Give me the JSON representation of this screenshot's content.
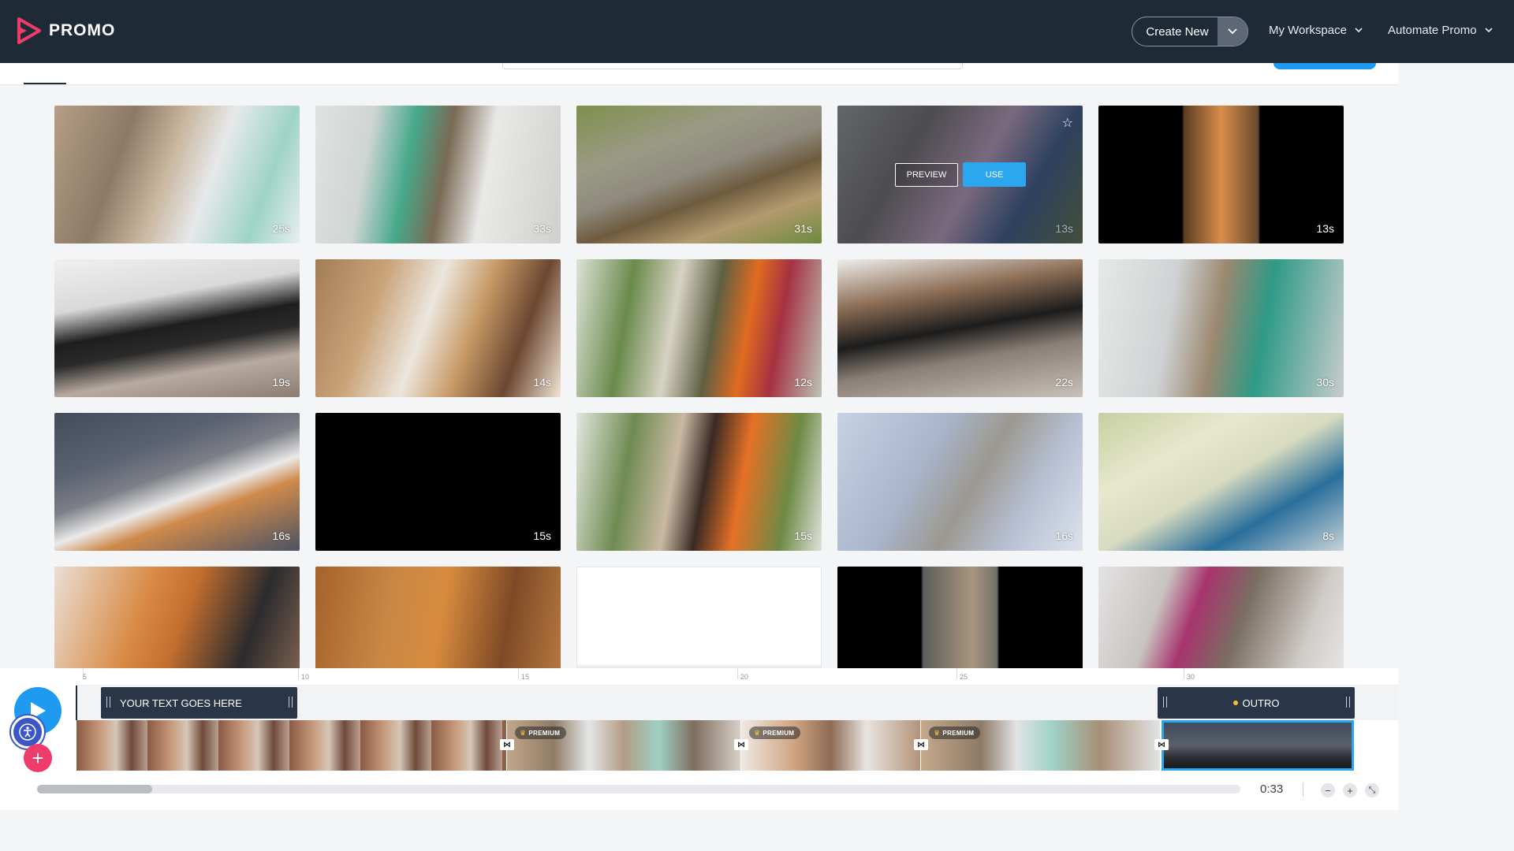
{
  "brand": {
    "name": "PROMO"
  },
  "header": {
    "create_new": "Create New",
    "nav": [
      "My Workspace",
      "Automate Promo"
    ]
  },
  "grid": {
    "hover_actions": {
      "preview": "PREVIEW",
      "use": "USE"
    },
    "items": [
      {
        "duration": "25s"
      },
      {
        "duration": "33s"
      },
      {
        "duration": "31s"
      },
      {
        "duration": "13s"
      },
      {
        "duration": "13s"
      },
      {
        "duration": "19s"
      },
      {
        "duration": "14s"
      },
      {
        "duration": "12s"
      },
      {
        "duration": "22s"
      },
      {
        "duration": "30s"
      },
      {
        "duration": "16s"
      },
      {
        "duration": "15s"
      },
      {
        "duration": "15s"
      },
      {
        "duration": "16s"
      },
      {
        "duration": "8s"
      },
      {
        "duration": ""
      },
      {
        "duration": ""
      },
      {
        "duration": ""
      },
      {
        "duration": ""
      },
      {
        "duration": ""
      }
    ]
  },
  "timeline": {
    "ruler_ticks": [
      "5",
      "10",
      "15",
      "20",
      "25",
      "30"
    ],
    "text_clip": "YOUR TEXT GOES HERE",
    "outro_clip": "OUTRO",
    "premium_label": "PREMIUM",
    "current_time": "0:33"
  },
  "colors": {
    "accent": "#1e9bf0",
    "brand": "#ef3c6b",
    "topbar": "#1f2a37"
  },
  "icons": [
    "play-icon",
    "accessibility-icon",
    "plus-icon",
    "chevron-down-icon",
    "star-icon",
    "zoom-out-icon",
    "zoom-in-icon",
    "fit-icon"
  ]
}
